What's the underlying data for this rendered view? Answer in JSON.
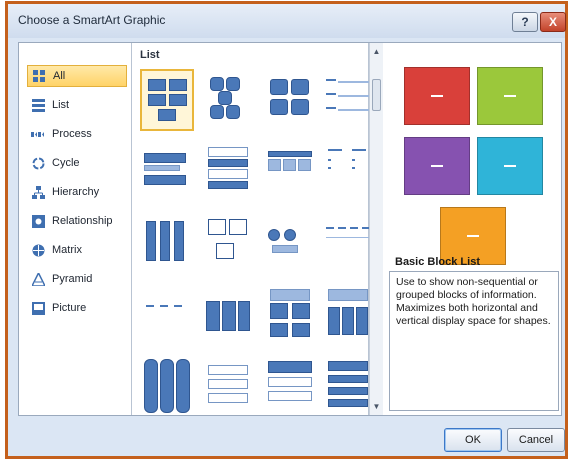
{
  "window": {
    "title": "Choose a SmartArt Graphic",
    "help_label": "?",
    "close_label": "X"
  },
  "categories": [
    {
      "label": "All",
      "icon": "grid-icon",
      "selected": true
    },
    {
      "label": "List",
      "icon": "list-icon"
    },
    {
      "label": "Process",
      "icon": "process-icon"
    },
    {
      "label": "Cycle",
      "icon": "cycle-icon"
    },
    {
      "label": "Hierarchy",
      "icon": "hierarchy-icon"
    },
    {
      "label": "Relationship",
      "icon": "relationship-icon"
    },
    {
      "label": "Matrix",
      "icon": "matrix-icon"
    },
    {
      "label": "Pyramid",
      "icon": "pyramid-icon"
    },
    {
      "label": "Picture",
      "icon": "picture-icon"
    }
  ],
  "gallery": {
    "section_label": "List"
  },
  "preview": {
    "name": "Basic Block List",
    "description": "Use to show non-sequential or grouped blocks of information. Maximizes both horizontal and vertical display space for shapes.",
    "colors": {
      "red": "#d9403a",
      "green": "#9bc83b",
      "purple": "#8652b0",
      "cyan": "#2fb4d8",
      "orange": "#f4a024"
    }
  },
  "buttons": {
    "ok": "OK",
    "cancel": "Cancel"
  }
}
